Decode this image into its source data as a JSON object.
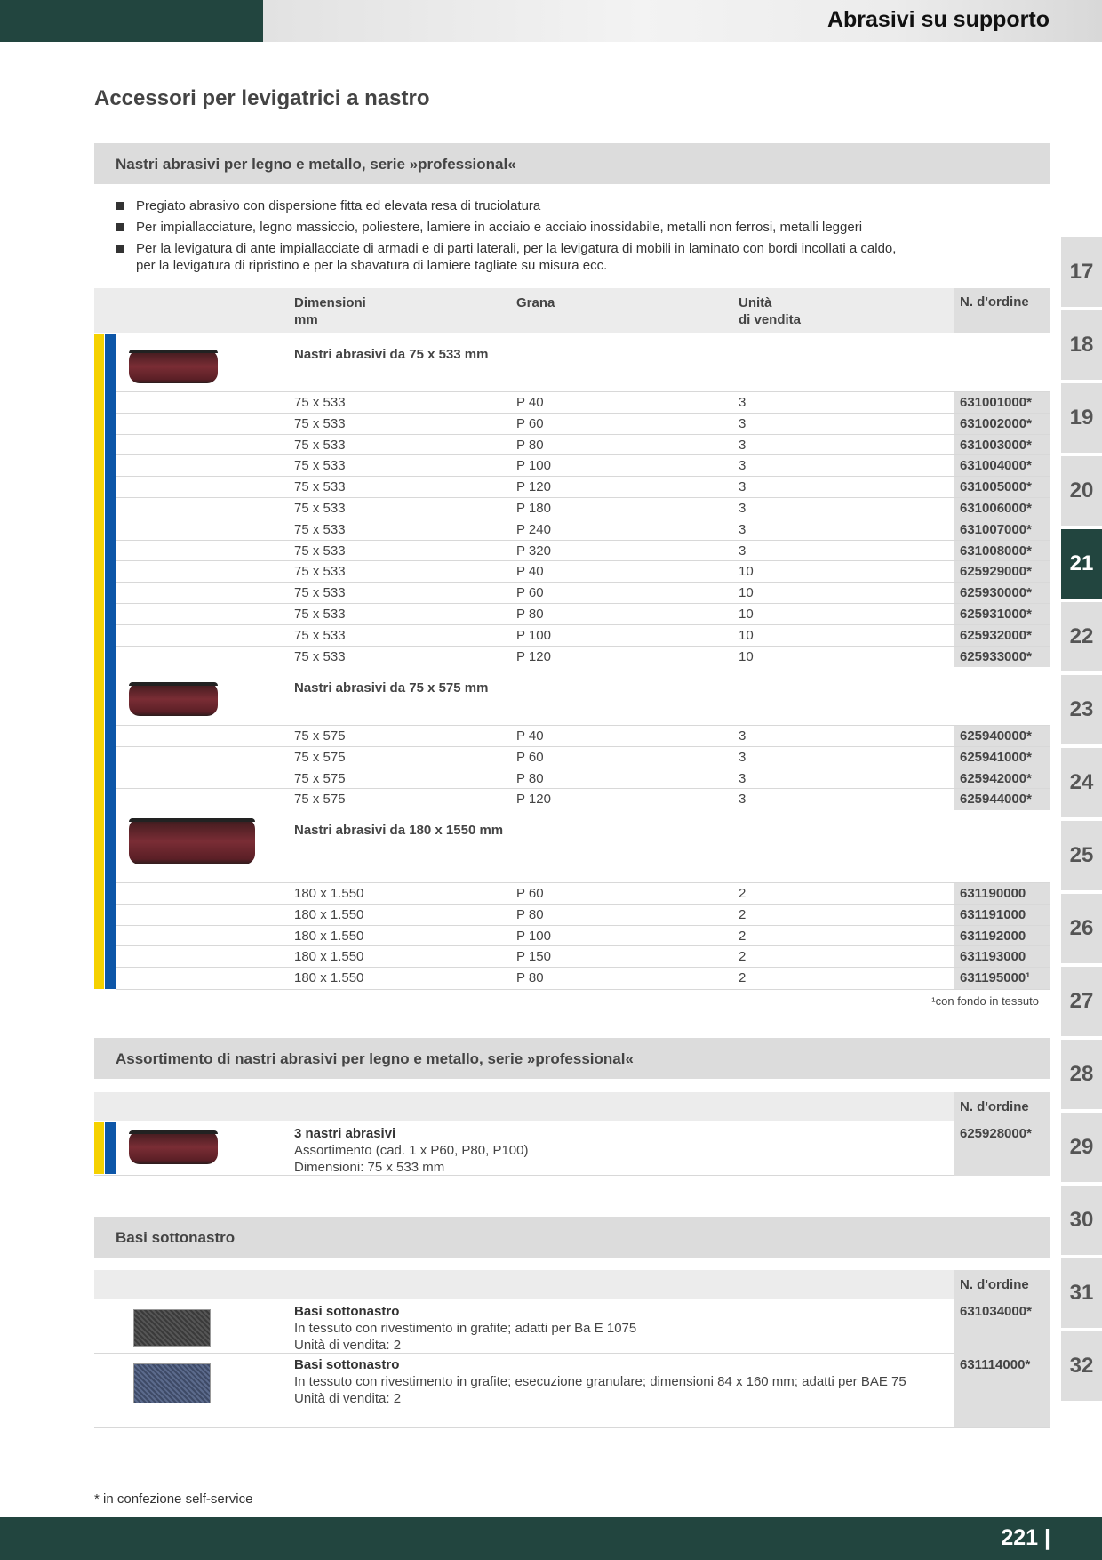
{
  "header": {
    "title": "Abrasivi su supporto"
  },
  "page_title": "Accessori per levigatrici a nastro",
  "section1": {
    "title": "Nastri abrasivi per legno e metallo, serie »professional«",
    "bullets": [
      "Pregiato abrasivo con dispersione fitta ed elevata resa di truciolatura",
      "Per impiallacciature, legno massiccio, poliestere, lamiere in acciaio e acciaio inossidabile, metalli non ferrosi, metalli leggeri",
      "Per la levigatura di ante impiallacciate di armadi e di parti laterali, per la levigatura di mobili in laminato con bordi incollati a caldo,",
      "per la levigatura di ripristino e per la sbavatura di lamiere tagliate su misura ecc."
    ],
    "headers": {
      "dim": "Dimensioni",
      "dim2": "mm",
      "grit": "Grana",
      "unit": "Unità",
      "unit2": "di vendita",
      "order": "N. d'ordine"
    },
    "groups": [
      {
        "title": "Nastri abrasivi da 75 x 533 mm",
        "rows": [
          [
            "75 x 533",
            "P 40",
            "3",
            "631001000*"
          ],
          [
            "75 x 533",
            "P 60",
            "3",
            "631002000*"
          ],
          [
            "75 x 533",
            "P 80",
            "3",
            "631003000*"
          ],
          [
            "75 x 533",
            "P 100",
            "3",
            "631004000*"
          ],
          [
            "75 x 533",
            "P 120",
            "3",
            "631005000*"
          ],
          [
            "75 x 533",
            "P 180",
            "3",
            "631006000*"
          ],
          [
            "75 x 533",
            "P 240",
            "3",
            "631007000*"
          ],
          [
            "75 x 533",
            "P 320",
            "3",
            "631008000*"
          ],
          [
            "75 x 533",
            "P 40",
            "10",
            "625929000*"
          ],
          [
            "75 x 533",
            "P 60",
            "10",
            "625930000*"
          ],
          [
            "75 x 533",
            "P 80",
            "10",
            "625931000*"
          ],
          [
            "75 x 533",
            "P 100",
            "10",
            "625932000*"
          ],
          [
            "75 x 533",
            "P 120",
            "10",
            "625933000*"
          ]
        ]
      },
      {
        "title": "Nastri abrasivi da 75 x 575 mm",
        "rows": [
          [
            "75 x 575",
            "P 40",
            "3",
            "625940000*"
          ],
          [
            "75 x 575",
            "P 60",
            "3",
            "625941000*"
          ],
          [
            "75 x 575",
            "P 80",
            "3",
            "625942000*"
          ],
          [
            "75 x 575",
            "P 120",
            "3",
            "625944000*"
          ]
        ]
      },
      {
        "title": "Nastri abrasivi da 180 x 1550 mm",
        "rows": [
          [
            "180 x 1.550",
            "P 60",
            "2",
            "631190000"
          ],
          [
            "180 x 1.550",
            "P 80",
            "2",
            "631191000"
          ],
          [
            "180 x 1.550",
            "P 100",
            "2",
            "631192000"
          ],
          [
            "180 x 1.550",
            "P 150",
            "2",
            "631193000"
          ],
          [
            "180 x 1.550",
            "P 80",
            "2",
            "631195000¹"
          ]
        ]
      }
    ],
    "footnote": "¹con fondo in tessuto"
  },
  "section2": {
    "title": "Assortimento di nastri abrasivi per legno e metallo, serie »professional«",
    "order_header": "N. d'ordine",
    "item": {
      "name": "3 nastri abrasivi",
      "line1": "Assortimento (cad. 1 x P60, P80, P100)",
      "line2": "Dimensioni: 75 x 533 mm",
      "order": "625928000*"
    }
  },
  "section3": {
    "title": "Basi sottonastro",
    "order_header": "N. d'ordine",
    "items": [
      {
        "name": "Basi sottonastro",
        "line1": "In tessuto con rivestimento in grafite; adatti per Ba E 1075",
        "line2": "Unità di vendita: 2",
        "order": "631034000*"
      },
      {
        "name": "Basi sottonastro",
        "line1": "In tessuto con rivestimento in grafite; esecuzione granulare; dimensioni 84 x 160 mm; adatti per BAE 75",
        "line2": "Unità di vendita: 2",
        "order": "631114000*"
      }
    ]
  },
  "side_tabs": [
    "17",
    "18",
    "19",
    "20",
    "21",
    "22",
    "23",
    "24",
    "25",
    "26",
    "27",
    "28",
    "29",
    "30",
    "31",
    "32"
  ],
  "active_tab": "21",
  "bottom_note": "* in confezione self-service",
  "page_number": "221 |"
}
